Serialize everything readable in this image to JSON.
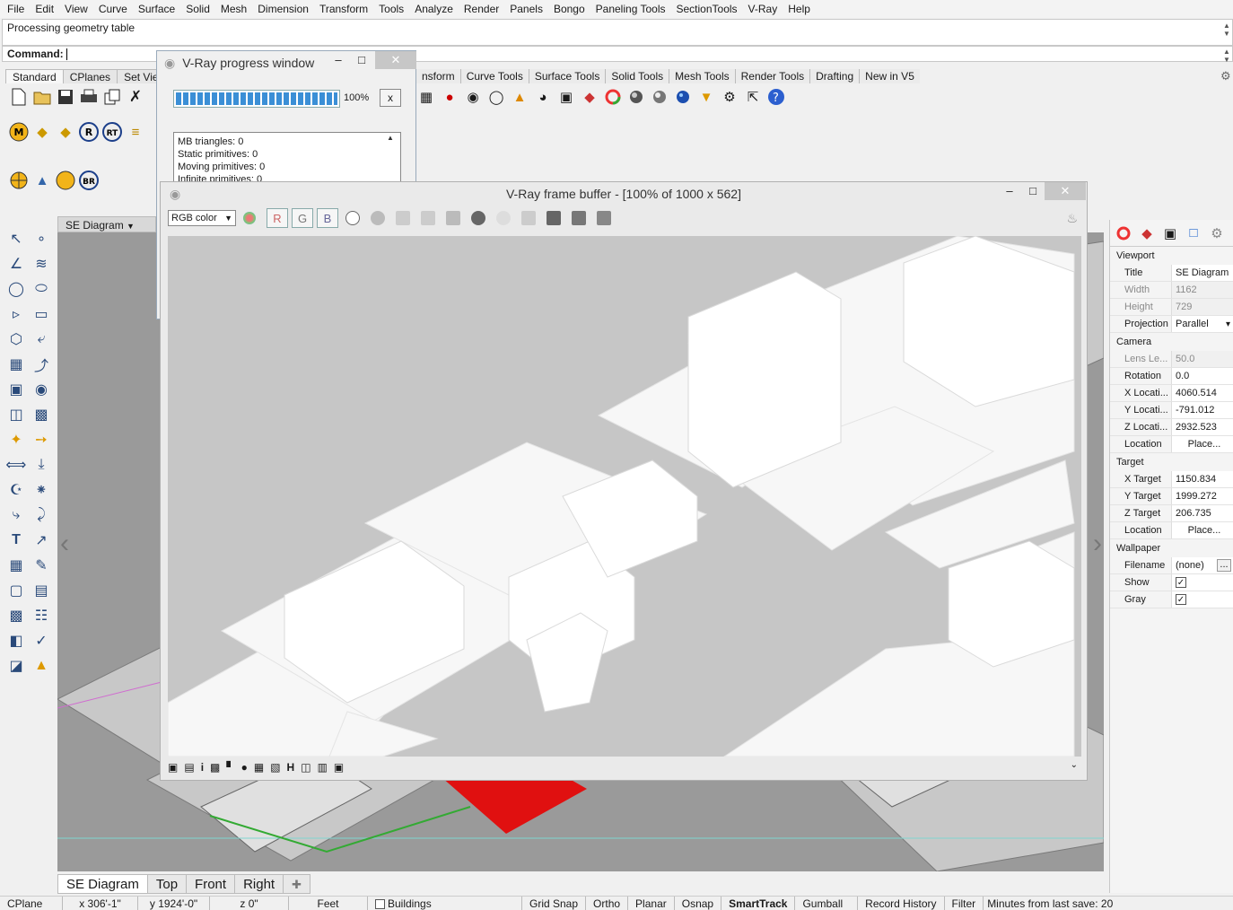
{
  "menu": [
    "File",
    "Edit",
    "View",
    "Curve",
    "Surface",
    "Solid",
    "Mesh",
    "Dimension",
    "Transform",
    "Tools",
    "Analyze",
    "Render",
    "Panels",
    "Bongo",
    "Paneling Tools",
    "SectionTools",
    "V-Ray",
    "Help"
  ],
  "command": {
    "history": "Processing geometry table",
    "prompt": "Command:"
  },
  "toolbar_tabs_left": [
    "Standard",
    "CPlanes",
    "Set Viev"
  ],
  "toolbar_tabs_right": [
    "nsform",
    "Curve Tools",
    "Surface Tools",
    "Solid Tools",
    "Mesh Tools",
    "Render Tools",
    "Drafting",
    "New in V5"
  ],
  "toolbar_badges": {
    "m": "M",
    "r": "R",
    "rt": "RT",
    "br": "BR"
  },
  "progress_window": {
    "title": "V-Ray progress window",
    "percent": "100%",
    "cancel": "x",
    "log": [
      "MB triangles: 0",
      "Static primitives: 0",
      "Moving primitives: 0",
      "Infinite primitives: 0"
    ]
  },
  "frame_buffer": {
    "title": "V-Ray frame buffer - [100% of 1000 x 562]",
    "channel_select": "RGB color",
    "channels": [
      "R",
      "G",
      "B"
    ]
  },
  "viewport": {
    "title": "SE Diagram"
  },
  "viewport_tabs": [
    "SE Diagram",
    "Top",
    "Front",
    "Right"
  ],
  "properties": {
    "groups": {
      "viewport": "Viewport",
      "camera": "Camera",
      "target": "Target",
      "wallpaper": "Wallpaper"
    },
    "viewport_rows": [
      {
        "k": "Title",
        "v": "SE Diagram",
        "dim": false
      },
      {
        "k": "Width",
        "v": "1162",
        "dim": true
      },
      {
        "k": "Height",
        "v": "729",
        "dim": true
      },
      {
        "k": "Projection",
        "v": "Parallel",
        "dim": false
      }
    ],
    "camera_rows": [
      {
        "k": "Lens Le...",
        "v": "50.0",
        "dim": true
      },
      {
        "k": "Rotation",
        "v": "0.0",
        "dim": false
      },
      {
        "k": "X Locati...",
        "v": "4060.514",
        "dim": false
      },
      {
        "k": "Y Locati...",
        "v": "-791.012",
        "dim": false
      },
      {
        "k": "Z Locati...",
        "v": "2932.523",
        "dim": false
      },
      {
        "k": "Location",
        "v": "Place...",
        "dim": false
      }
    ],
    "target_rows": [
      {
        "k": "X Target",
        "v": "1150.834",
        "dim": false
      },
      {
        "k": "Y Target",
        "v": "1999.272",
        "dim": false
      },
      {
        "k": "Z Target",
        "v": "206.735",
        "dim": false
      },
      {
        "k": "Location",
        "v": "Place...",
        "dim": false
      }
    ],
    "wallpaper_rows": [
      {
        "k": "Filename",
        "v": "(none)",
        "dim": false
      },
      {
        "k": "Show",
        "v": "✓",
        "dim": false
      },
      {
        "k": "Gray",
        "v": "✓",
        "dim": false
      }
    ],
    "browse": "..."
  },
  "status": {
    "cplane": "CPlane",
    "x": "x 306'-1\"",
    "y": "y 1924'-0\"",
    "z": "z 0\"",
    "units": "Feet",
    "layer": "Buildings",
    "grid_snap": "Grid Snap",
    "ortho": "Ortho",
    "planar": "Planar",
    "osnap": "Osnap",
    "smarttrack": "SmartTrack",
    "gumball": "Gumball",
    "record_history": "Record History",
    "filter": "Filter",
    "save_info": "Minutes from last save: 20"
  },
  "colors": {
    "accent": "#3b8fd6",
    "render_bg": "#c6c6c6",
    "building": "#f7f7f7",
    "viewport_bg": "#9a9a9a",
    "red_building": "#e01010"
  }
}
